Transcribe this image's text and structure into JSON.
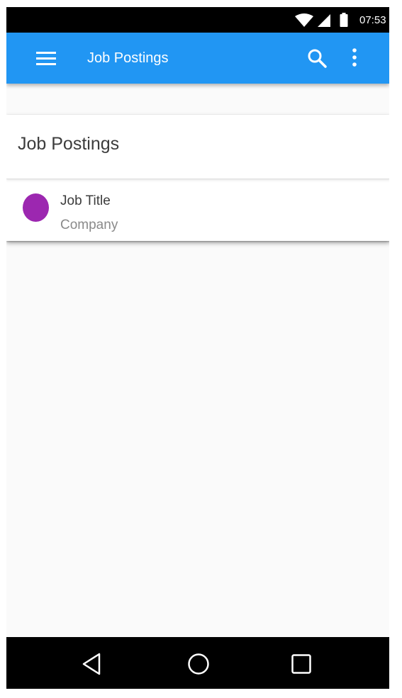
{
  "status_bar": {
    "time": "07:53",
    "icons": [
      "wifi-icon",
      "signal-icon",
      "battery-icon"
    ]
  },
  "app_bar": {
    "title": "Job Postings",
    "actions": [
      "menu-icon",
      "search-icon",
      "more-vert-icon"
    ],
    "color": "#2196f3"
  },
  "card": {
    "title": "Job Postings",
    "items": [
      {
        "title": "Job Title",
        "subtitle": "Company",
        "avatar_color": "#9c27b0"
      }
    ]
  },
  "nav_bar": {
    "buttons": [
      "back-icon",
      "home-icon",
      "recents-icon"
    ]
  }
}
